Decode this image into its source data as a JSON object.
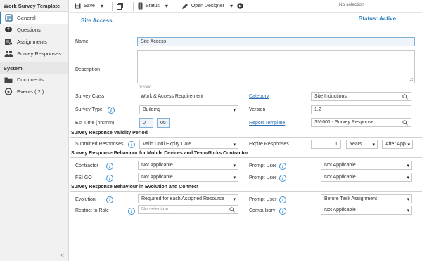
{
  "sidebar": {
    "title": "Work Survey Template",
    "items": [
      {
        "label": "General",
        "icon": "clipboard-icon",
        "active": true
      },
      {
        "label": "Questions",
        "icon": "question-bubble-icon"
      },
      {
        "label": "Assignments",
        "icon": "assignment-icon"
      },
      {
        "label": "Survey Responses",
        "icon": "people-icon"
      }
    ],
    "section": "System",
    "system_items": [
      {
        "label": "Documents",
        "icon": "folder-icon"
      },
      {
        "label": "Events ( 2 )",
        "icon": "events-icon"
      }
    ],
    "collapse": "«"
  },
  "toolbar": {
    "save": "Save",
    "status": "Status",
    "open_designer": "Open Designer",
    "no_selection": "No selection"
  },
  "header": {
    "title": "Site Access",
    "status": "Status: Active"
  },
  "form": {
    "name_label": "Name",
    "name_value": "Site Access",
    "description_label": "Description",
    "description_value": "",
    "char_counter": "0/2000",
    "survey_class_label": "Survey Class",
    "survey_class_value": "Work & Access Requirement",
    "category_label": "Category",
    "category_value": "Site Inductions",
    "survey_type_label": "Survey Type",
    "survey_type_value": "Building",
    "version_label": "Version",
    "version_value": "1.2",
    "est_time_label": "Est Time (hh:mm)",
    "est_hours": "0",
    "est_minutes": "05",
    "report_template_label": "Report Template",
    "report_template_value": "SV-001 - Survey Response"
  },
  "validity": {
    "section_title": "Survey Response Validity Period",
    "submitted_label": "Submitted Responses",
    "submitted_value": "Valid Until Expiry Date",
    "expire_label": "Expire Responses",
    "expire_number": "1",
    "expire_unit": "Years",
    "expire_when": "After App"
  },
  "mobile": {
    "section_title": "Survey Response Behaviour for Mobile Devices and TeamWorks Contractor",
    "contractor_label": "Contractor",
    "contractor_value": "Not Applicable",
    "prompt_user_label": "Prompt User",
    "prompt_user_value": "Not Applicable",
    "fsi_label": "FSI GO",
    "fsi_value": "Not Applicable",
    "prompt_user2_label": "Prompt User",
    "prompt_user2_value": "Not Applicable"
  },
  "evolution": {
    "section_title": "Survey Response Behaviour in Evolution and Connect",
    "evolution_label": "Evolution",
    "evolution_value": "Required for each Assigned Resource",
    "prompt_user_label": "Prompt User",
    "prompt_user_value": "Before Task Assignment",
    "restrict_label": "Restrict to Role",
    "restrict_placeholder": "No selection",
    "compulsory_label": "Compulsory",
    "compulsory_value": "Not Applicable"
  },
  "colors": {
    "accent": "#2a7fbf",
    "link": "#2a6fb0",
    "highlight_field": "#eef4fa"
  }
}
